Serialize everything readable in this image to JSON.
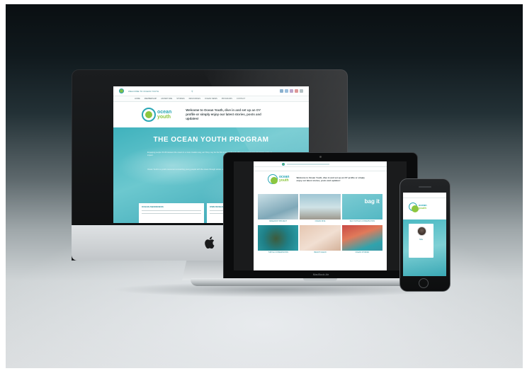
{
  "imac_site": {
    "top_text": "WELCOME TO OCEAN YOUTH",
    "nav": [
      "HOME",
      "MEMBERSHIP",
      "ADVENTURE",
      "STORIES",
      "RESOURCES",
      "OCEAN NEWS",
      "PROGRAMS",
      "CONTACT"
    ],
    "logo_line1": "ocean",
    "logo_line2": "youth",
    "welcome": "Welcome to Ocean Youth, dive in and set up an OY profile or simply enjoy our latest stories, posts and updates!",
    "hero_title": "THE OCEAN YOUTH PROGRAM",
    "hero_p1": "Engaging people 15-30 between the ocean in a more creative way, as if they may be the first in the world and willing to use their own potential to make an impact.",
    "hero_p2": "Ocean Youth is a youth movement connecting young people with the ocean through stories, adventure, science and advocacy across the globe.",
    "cards": [
      "OCEAN AWARENESS",
      "OWN RESEARCH"
    ]
  },
  "macbook": {
    "label": "MacBook Air",
    "logo_line1": "ocean",
    "logo_line2": "youth",
    "welcome": "Welcome to Ocean Youth, dive in and set up an OY profile or simply enjoy our latest stories, posts and updates!",
    "bag_it": "bag it",
    "tiles": [
      "RESEARCH PROJECT",
      "OCEAN DIVE",
      "SEA TURTLES CONSERVATION",
      "TURTLE CONSERVATION",
      "BEACH CLEAN",
      "OCEAN STORIES"
    ]
  },
  "iphone": {
    "logo_line1": "ocean",
    "logo_line2": "youth",
    "name": "Mia"
  },
  "colors": {
    "brand_teal": "#2aa7b5",
    "brand_green": "#8cc63f",
    "hero_teal": "#3fb2bd"
  }
}
